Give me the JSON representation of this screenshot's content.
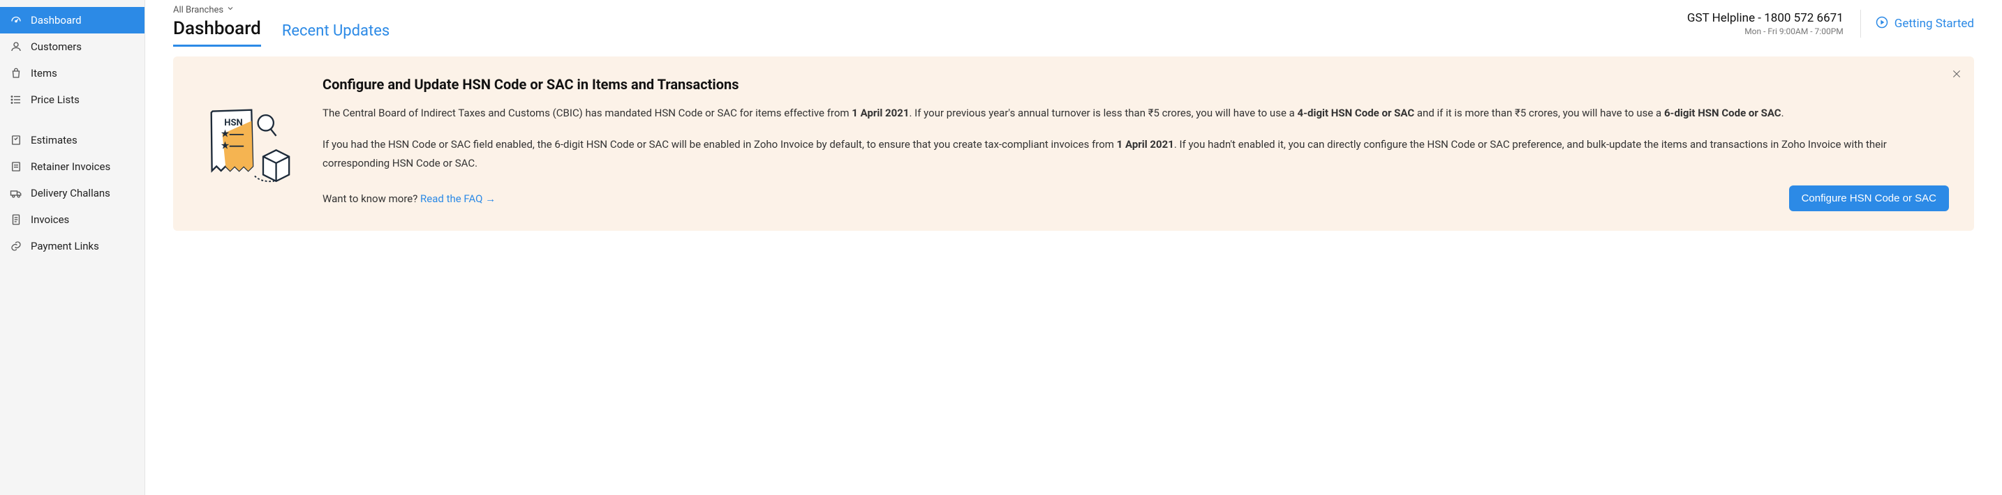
{
  "sidebar": {
    "items": [
      {
        "label": "Dashboard",
        "icon": "gauge-icon",
        "active": true
      },
      {
        "label": "Customers",
        "icon": "person-icon"
      },
      {
        "label": "Items",
        "icon": "bag-icon"
      },
      {
        "label": "Price Lists",
        "icon": "list-icon"
      },
      {
        "label": "Estimates",
        "icon": "estimate-icon"
      },
      {
        "label": "Retainer Invoices",
        "icon": "retainer-icon"
      },
      {
        "label": "Delivery Challans",
        "icon": "truck-icon"
      },
      {
        "label": "Invoices",
        "icon": "doc-icon"
      },
      {
        "label": "Payment Links",
        "icon": "link-icon"
      }
    ]
  },
  "header": {
    "branch_label": "All Branches",
    "title": "Dashboard",
    "recent_updates": "Recent Updates",
    "helpline_top": "GST Helpline - 1800 572 6671",
    "helpline_bottom": "Mon - Fri 9:00AM - 7:00PM",
    "getting_started": "Getting Started"
  },
  "banner": {
    "title": "Configure and Update HSN Code or SAC in Items and Transactions",
    "p1_a": "The Central Board of Indirect Taxes and Customs (CBIC) has mandated HSN Code or SAC for items effective from ",
    "p1_b1": "1 April 2021",
    "p1_c": ". If your previous year's annual turnover is less than ₹5 crores, you will have to use a ",
    "p1_b2": "4-digit HSN Code or SAC",
    "p1_d": " and if it is more than ₹5 crores, you will have to use a ",
    "p1_b3": "6-digit HSN Code or SAC",
    "p1_e": ".",
    "p2_a": "If you had the HSN Code or SAC field enabled, the 6-digit HSN Code or SAC will be enabled in Zoho Invoice by default, to ensure that you create tax-compliant invoices from ",
    "p2_b1": "1 April 2021",
    "p2_c": ". If you hadn't enabled it, you can directly configure the HSN Code or SAC preference, and bulk-update the items and transactions in Zoho Invoice with their corresponding HSN Code or SAC.",
    "faq_prompt": "Want to know more? ",
    "faq_link": "Read the FAQ",
    "cta": "Configure HSN Code or SAC",
    "illus_text": "HSN"
  }
}
